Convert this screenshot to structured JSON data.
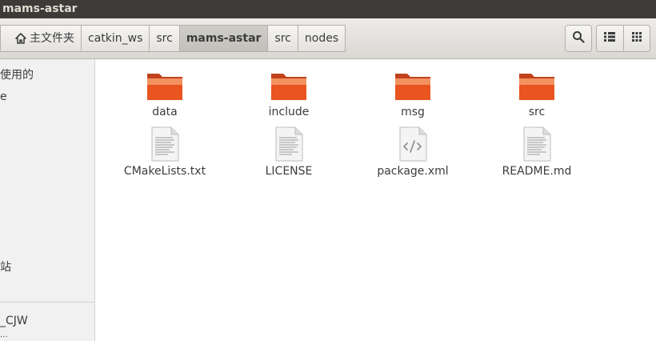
{
  "window": {
    "title": "mams-astar"
  },
  "breadcrumb": [
    {
      "label": "主文件夹",
      "icon": "home-icon"
    },
    {
      "label": "catkin_ws"
    },
    {
      "label": "src"
    },
    {
      "label": "mams-astar",
      "active": true
    },
    {
      "label": "src"
    },
    {
      "label": "nodes"
    }
  ],
  "toolbar": {
    "search_icon": "search-icon",
    "list_view_icon": "list-view-icon",
    "grid_view_icon": "grid-view-icon"
  },
  "sidebar": {
    "items": [
      {
        "label": "使用的"
      },
      {
        "label": "e"
      },
      {
        "label": "站"
      },
      {
        "label": "_CJW"
      },
      {
        "label": "..."
      }
    ]
  },
  "files": [
    {
      "name": "data",
      "type": "folder"
    },
    {
      "name": "include",
      "type": "folder"
    },
    {
      "name": "msg",
      "type": "folder"
    },
    {
      "name": "src",
      "type": "folder"
    },
    {
      "name": "CMakeLists.txt",
      "type": "text"
    },
    {
      "name": "LICENSE",
      "type": "text"
    },
    {
      "name": "package.xml",
      "type": "xml"
    },
    {
      "name": "README.md",
      "type": "text"
    }
  ],
  "colors": {
    "titlebar": "#3c3b37",
    "folder": "#e95420",
    "folder_light": "#f39160"
  }
}
